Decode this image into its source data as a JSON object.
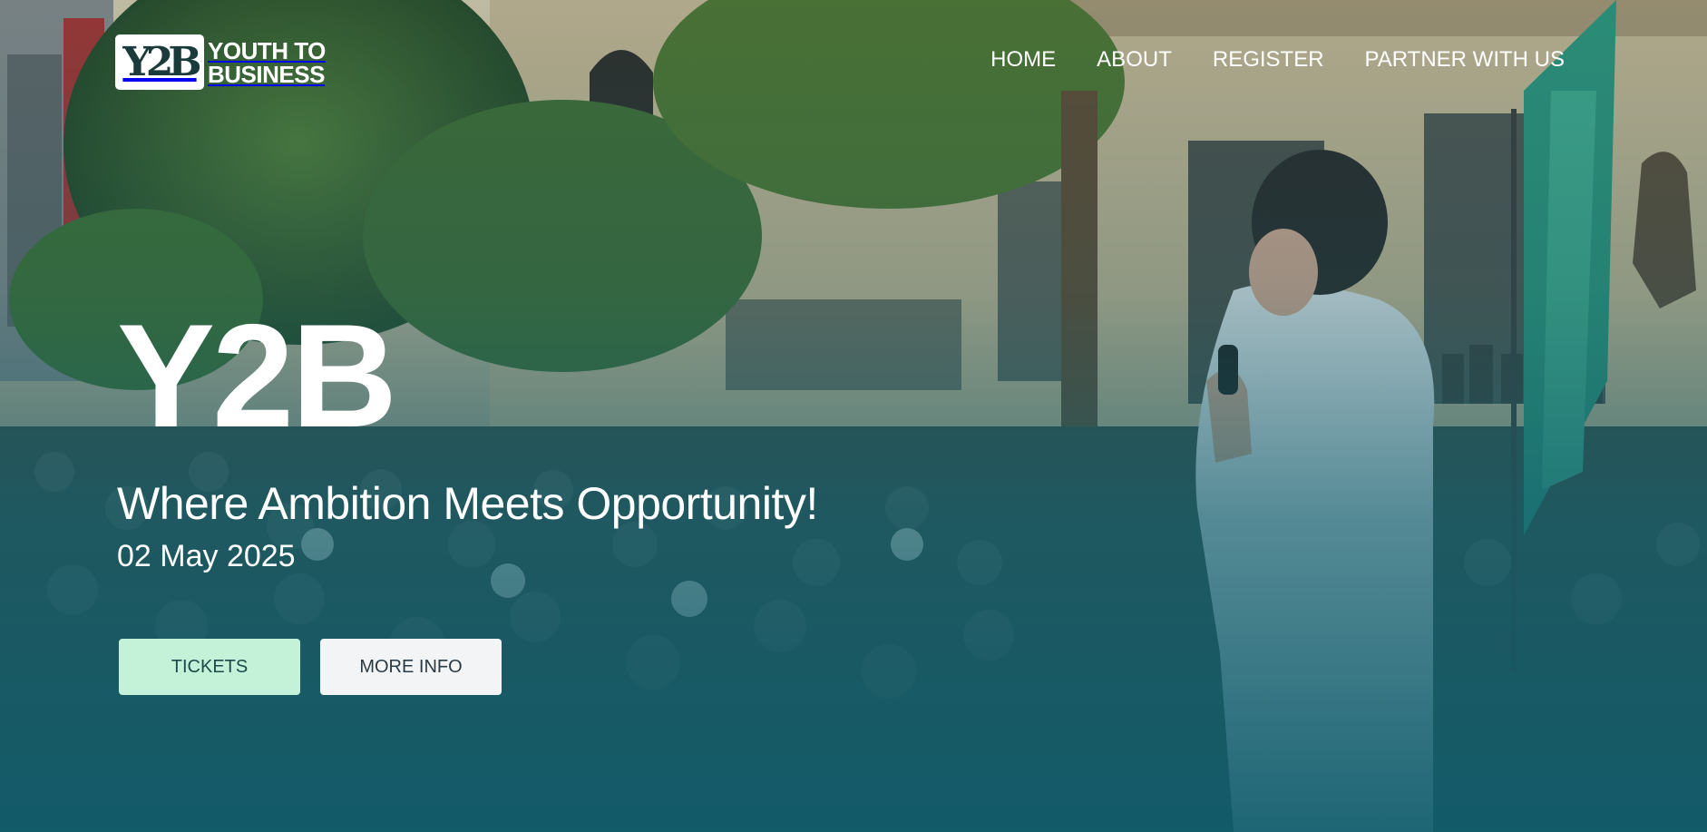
{
  "brand": {
    "logo_mark": "Y2B",
    "name_line1": "YOUTH TO",
    "name_line2": "BUSINESS"
  },
  "nav": {
    "items": [
      {
        "label": "HOME"
      },
      {
        "label": "ABOUT"
      },
      {
        "label": "REGISTER"
      },
      {
        "label": "PARTNER WITH US"
      }
    ]
  },
  "hero": {
    "title": "Y2B",
    "tagline": "Where Ambition Meets Opportunity!",
    "date": "02 May 2025",
    "buttons": {
      "tickets_label": "TICKETS",
      "more_info_label": "MORE INFO"
    }
  },
  "colors": {
    "overlay_teal": "#0f5c6c",
    "tickets_button_bg": "#c3f2d9",
    "more_info_button_bg": "#f3f4f5",
    "text": "#ffffff"
  }
}
